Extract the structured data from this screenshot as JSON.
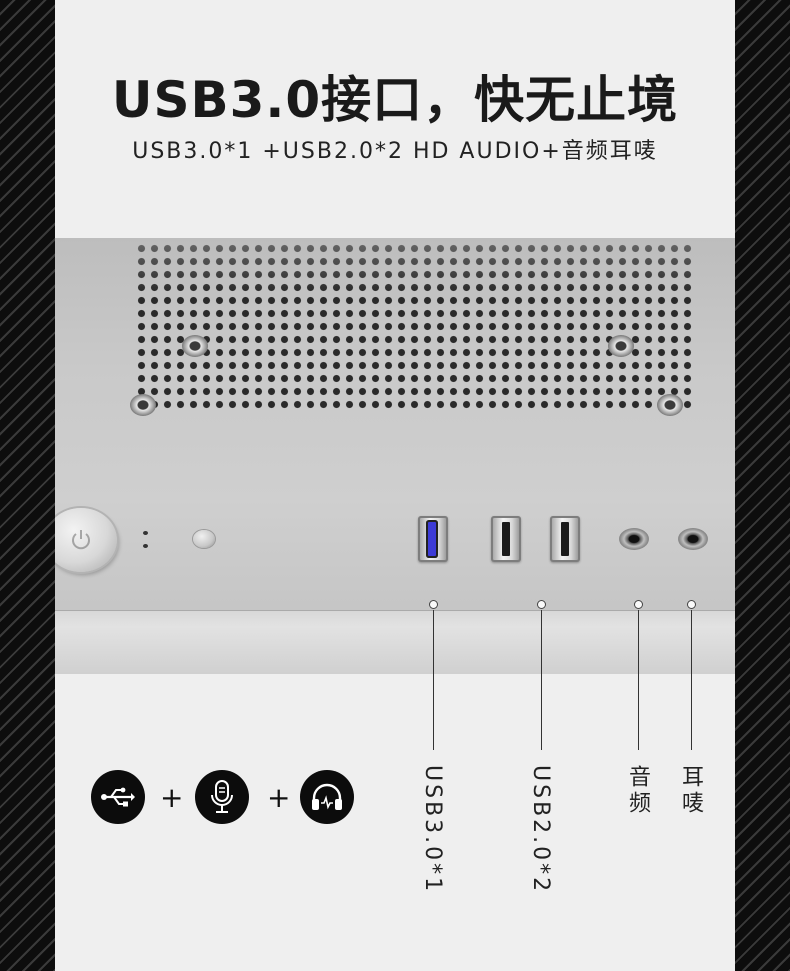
{
  "headline": "USB3.0接口，快无止境",
  "subline": "USB3.0*1 +USB2.0*2 HD AUDIO+音频耳唛",
  "labels": {
    "usb3": "USB3.0*1",
    "usb2": "USB2.0*2",
    "audio": "音频",
    "mic": "耳唛"
  },
  "icons": [
    "usb-icon",
    "microphone-icon",
    "headphones-icon"
  ],
  "plus_sign": "+",
  "colors": {
    "border_dark": "#0d0d0d",
    "panel_bg": "#efefef",
    "usb3_blue": "#3d3bd6",
    "icon_bg": "#0c0c0c"
  }
}
